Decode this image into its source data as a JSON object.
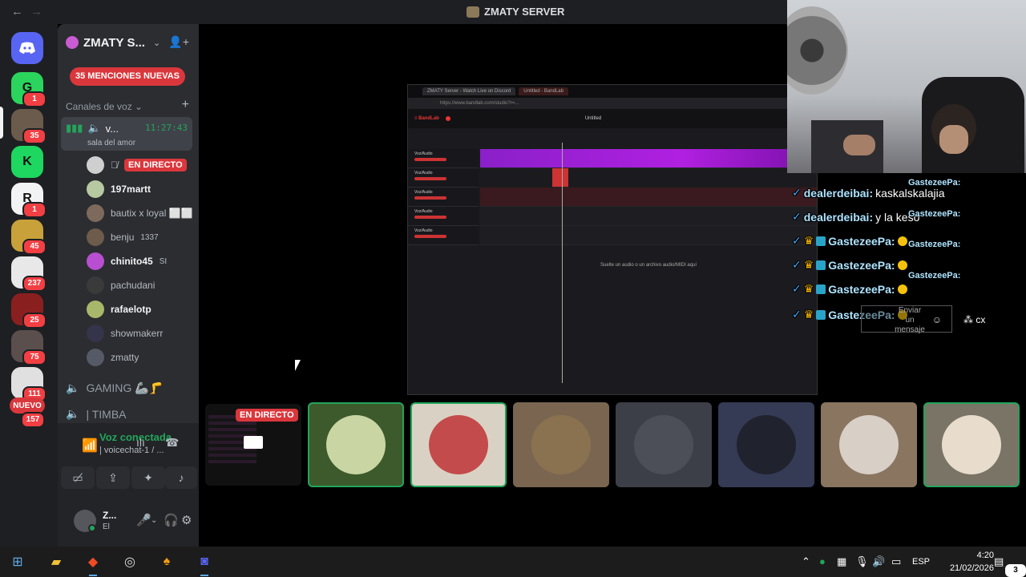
{
  "window": {
    "title": "ZMATY SERVER",
    "back": "←",
    "forward": "→"
  },
  "rail": {
    "guilds": [
      {
        "badge": "1",
        "color": "#2bd45c",
        "glyph": "G"
      },
      {
        "badge": "35",
        "color": "#6a5b4c",
        "glyph": ""
      },
      {
        "badge": "",
        "color": "#1ed760",
        "glyph": "K"
      },
      {
        "badge": "1",
        "color": "#f2f3f5",
        "glyph": "R"
      },
      {
        "badge": "45",
        "color": "#c9a13b",
        "glyph": ""
      },
      {
        "badge": "237",
        "color": "#e8e8e8",
        "glyph": ""
      },
      {
        "badge": "25",
        "color": "#8a1f1f",
        "glyph": ""
      },
      {
        "badge": "75",
        "color": "#5a4f4c",
        "glyph": ""
      },
      {
        "badge": "111",
        "color": "#e0e0e0",
        "glyph": ""
      }
    ],
    "new_label": "NUEVO",
    "new_badge": "157"
  },
  "sidebar": {
    "server_name": "ZMATY S...",
    "mentions": "35 MENCIONES NUEVAS",
    "category": "Canales de voz",
    "active_channel": {
      "name": "v...",
      "time": "11:27:43",
      "sub": "sala del amor"
    },
    "live_label": "EN DIRECTO",
    "members": [
      {
        "name": "197martt",
        "bold": true,
        "extra": "",
        "color": "#b7c9a0"
      },
      {
        "name": "bautix x loyal ⬜⬜",
        "bold": false,
        "extra": "",
        "color": "#7d6a5c"
      },
      {
        "name": "benju",
        "bold": false,
        "extra": "1337",
        "color": "#6d5b4b"
      },
      {
        "name": "chinito45",
        "bold": true,
        "extra": "SI",
        "color": "#b74fd0"
      },
      {
        "name": "pachudani",
        "bold": false,
        "extra": "",
        "color": "#3a3a3a"
      },
      {
        "name": "rafaelotp",
        "bold": true,
        "extra": "",
        "color": "#a7b86a"
      },
      {
        "name": "showmakerr",
        "bold": false,
        "extra": "",
        "color": "#34344a"
      },
      {
        "name": "zmatty",
        "bold": false,
        "extra": "",
        "color": "#555a66"
      }
    ],
    "channels": [
      {
        "name": "GAMING 🦾🦵"
      },
      {
        "name": "| TIMBA"
      }
    ]
  },
  "voice": {
    "connected": "Voz conectada",
    "channel": "| voicechat-1 / ...",
    "user_name": "Z...",
    "user_status": "El"
  },
  "screen": {
    "tab1": "ZMATY Server - Watch Live on Discord",
    "tab2": "Untitled - BandLab",
    "url": "https://www.bandlab.com/studio?r=...",
    "project": "Untitled",
    "drop_text": "Suelte un audio o un archivo audio/MIDI aquí",
    "tracks": [
      "Voz/Audio",
      "Voz/Audio",
      "Voz/Audio",
      "Voz/Audio",
      "Voz/Audio"
    ]
  },
  "chat": {
    "lines": [
      {
        "user": "dealerdeibai:",
        "text": "kaskalskalajia"
      },
      {
        "user": "dealerdeibai:",
        "text": "y la keso"
      },
      {
        "user": "GastezeePa:",
        "text": ""
      },
      {
        "user": "GastezeePa:",
        "text": ""
      },
      {
        "user": "GastezeePa:",
        "text": ""
      },
      {
        "user": "GastezeePa:",
        "text": ""
      }
    ],
    "side_user": "GastezeePa:",
    "composer": "Enviar un mensaje"
  },
  "stage": {
    "live_label": "EN DIRECTO"
  },
  "tiles": [
    {
      "color": "#3d5a2c",
      "inner": "#c9d6a3",
      "selected": true
    },
    {
      "color": "#d9d2c4",
      "inner": "#c44b4b",
      "selected": true
    },
    {
      "color": "#7a6650",
      "inner": "#8a7250",
      "selected": false
    },
    {
      "color": "#3c3f47",
      "inner": "#4c4f57",
      "selected": false
    },
    {
      "color": "#353a55",
      "inner": "#20232e",
      "selected": false
    },
    {
      "color": "#8a7560",
      "inner": "#d8cfc6",
      "selected": false
    },
    {
      "color": "#7a7466",
      "inner": "#e8dccd",
      "selected": true
    }
  ],
  "taskbar": {
    "language": "ESP",
    "time": "4:20",
    "date": "21/02/2026",
    "notifications": "3"
  }
}
